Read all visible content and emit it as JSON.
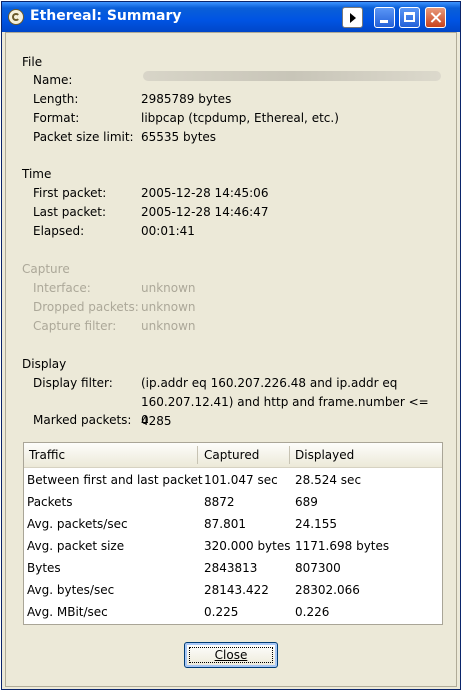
{
  "window": {
    "title": "Ethereal: Summary"
  },
  "file": {
    "heading": "File",
    "name_label": "Name:",
    "length_label": "Length:",
    "length_value": "2985789 bytes",
    "format_label": "Format:",
    "format_value": "libpcap (tcpdump, Ethereal, etc.)",
    "psl_label": "Packet size limit:",
    "psl_value": "65535 bytes"
  },
  "time": {
    "heading": "Time",
    "first_label": "First packet:",
    "first_value": "2005-12-28 14:45:06",
    "last_label": "Last packet:",
    "last_value": "2005-12-28 14:46:47",
    "elapsed_label": "Elapsed:",
    "elapsed_value": "00:01:41"
  },
  "capture": {
    "heading": "Capture",
    "interface_label": "Interface:",
    "interface_value": "unknown",
    "dropped_label": "Dropped packets:",
    "dropped_value": "unknown",
    "filter_label": "Capture filter:",
    "filter_value": "unknown"
  },
  "display": {
    "heading": "Display",
    "filter_label": "Display filter:",
    "filter_value": "(ip.addr eq 160.207.226.48 and ip.addr eq 160.207.12.41) and http and frame.number <= 4285",
    "marked_label": "Marked packets:",
    "marked_value": "0"
  },
  "traffic": {
    "headers": [
      "Traffic",
      "Captured",
      "Displayed"
    ],
    "rows": [
      [
        "Between first and last packet",
        "101.047 sec",
        "28.524 sec"
      ],
      [
        "Packets",
        "8872",
        "689"
      ],
      [
        "Avg. packets/sec",
        "87.801",
        "24.155"
      ],
      [
        "Avg. packet size",
        "320.000 bytes",
        "1171.698 bytes"
      ],
      [
        "Bytes",
        "2843813",
        "807300"
      ],
      [
        "Avg. bytes/sec",
        "28143.422",
        "28302.066"
      ],
      [
        "Avg. MBit/sec",
        "0.225",
        "0.226"
      ]
    ]
  },
  "buttons": {
    "close": "Close"
  },
  "icons": {
    "app": "ethereal-icon",
    "menu": "menu-arrow-icon",
    "minimize": "minimize-icon",
    "maximize": "maximize-icon",
    "close": "close-icon"
  },
  "colors": {
    "title_bar": "#0054e3",
    "disabled_text": "#aca899",
    "dialog_bg": "#ece9d8"
  }
}
